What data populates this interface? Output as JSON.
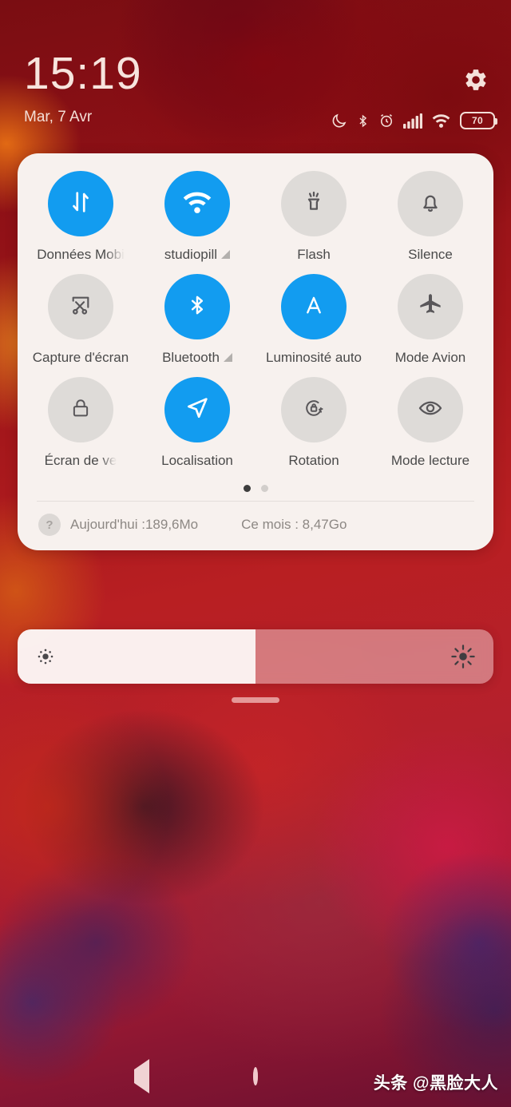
{
  "statusbar": {
    "time": "15:19",
    "date": "Mar, 7 Avr",
    "settings_icon": "gear-icon",
    "icons": [
      "dnd-moon-icon",
      "bluetooth-icon",
      "alarm-icon",
      "signal-bars-icon",
      "wifi-icon"
    ],
    "battery_level": "70"
  },
  "quick_settings": {
    "rows": [
      [
        {
          "label": "Données Mobi",
          "icon": "mobile-data-icon",
          "active": true,
          "truncated": true,
          "expandable": false
        },
        {
          "label": "studiopill",
          "icon": "wifi-icon",
          "active": true,
          "truncated": false,
          "expandable": true
        },
        {
          "label": "Flash",
          "icon": "flashlight-icon",
          "active": false,
          "truncated": false,
          "expandable": false
        },
        {
          "label": "Silence",
          "icon": "bell-icon",
          "active": false,
          "truncated": false,
          "expandable": false
        }
      ],
      [
        {
          "label": "Capture d'écran",
          "icon": "screenshot-scissors-icon",
          "active": false,
          "truncated": false,
          "expandable": false
        },
        {
          "label": "Bluetooth",
          "icon": "bluetooth-icon",
          "active": true,
          "truncated": false,
          "expandable": true
        },
        {
          "label": "Luminosité auto",
          "icon": "auto-brightness-a-icon",
          "active": true,
          "truncated": false,
          "expandable": false
        },
        {
          "label": "Mode Avion",
          "icon": "airplane-icon",
          "active": false,
          "truncated": false,
          "expandable": false
        }
      ],
      [
        {
          "label": "Écran de ve",
          "icon": "lock-screen-icon",
          "active": false,
          "truncated": true,
          "expandable": false
        },
        {
          "label": "Localisation",
          "icon": "location-arrow-icon",
          "active": true,
          "truncated": false,
          "expandable": false
        },
        {
          "label": "Rotation",
          "icon": "rotation-lock-icon",
          "active": false,
          "truncated": false,
          "expandable": false
        },
        {
          "label": "Mode lecture",
          "icon": "eye-icon",
          "active": false,
          "truncated": false,
          "expandable": false
        }
      ]
    ],
    "pager": {
      "count": 2,
      "active_index": 0
    },
    "usage": {
      "help_icon": "question-mark-icon",
      "today": "Aujourd'hui :189,6Mo",
      "month": "Ce mois : 8,47Go"
    }
  },
  "brightness": {
    "value_percent": 50,
    "low_icon": "brightness-low-icon",
    "high_icon": "brightness-high-icon"
  },
  "drag_handle": "panel-drag-handle",
  "navbar": {
    "back": "back-triangle-icon",
    "home": "home-circle-icon",
    "recents": "recents-square-icon"
  },
  "watermark": "头条 @黑脸大人",
  "colors": {
    "accent_blue": "#129cf0",
    "tile_inactive": "#dedbd8",
    "panel_bg": "#f7f1ee"
  }
}
